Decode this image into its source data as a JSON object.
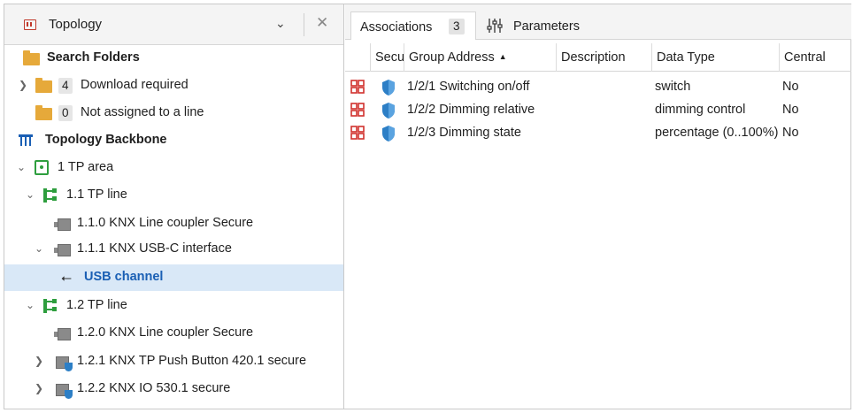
{
  "topology": {
    "title": "Topology",
    "search_folders": "Search Folders",
    "download_required": {
      "count": "4",
      "label": "Download required"
    },
    "not_assigned": {
      "count": "0",
      "label": "Not assigned to a line"
    },
    "backbone": "Topology Backbone",
    "area": "1 TP area",
    "line1": "1.1 TP line",
    "dev_110": "1.1.0 KNX Line coupler Secure",
    "dev_111": "1.1.1 KNX USB-C interface",
    "usb_channel": "USB channel",
    "line2": "1.2 TP line",
    "dev_120": "1.2.0 KNX Line coupler Secure",
    "dev_121": "1.2.1 KNX TP Push Button 420.1 secure",
    "dev_122": "1.2.2 KNX IO 530.1 secure"
  },
  "tabs": {
    "associations": "Associations",
    "associations_count": "3",
    "parameters": "Parameters"
  },
  "columns": {
    "secure": "Secu",
    "group_address": "Group Address",
    "description": "Description",
    "data_type": "Data Type",
    "central": "Central"
  },
  "rows": [
    {
      "group_address": "1/2/1 Switching on/off",
      "description": "",
      "data_type": "switch",
      "central": "No"
    },
    {
      "group_address": "1/2/2 Dimming relative",
      "description": "",
      "data_type": "dimming control",
      "central": "No"
    },
    {
      "group_address": "1/2/3 Dimming state",
      "description": "",
      "data_type": "percentage (0..100%)",
      "central": "No"
    }
  ],
  "colors": {
    "selection": "#d9e8f7",
    "selected_text": "#1a5fb4",
    "line_icon": "#2e9e3e",
    "folder": "#e6a93a",
    "shield": "#2d7fc6",
    "group_icon": "#d0312d"
  },
  "icons": {
    "topology": "topology-icon",
    "folder": "folder-icon",
    "backbone": "backbone-icon",
    "area": "area-icon",
    "line": "line-icon",
    "device": "device-icon",
    "usb": "usb-icon",
    "shield": "shield-icon",
    "group_address": "group-address-icon",
    "parameters": "sliders-icon"
  }
}
